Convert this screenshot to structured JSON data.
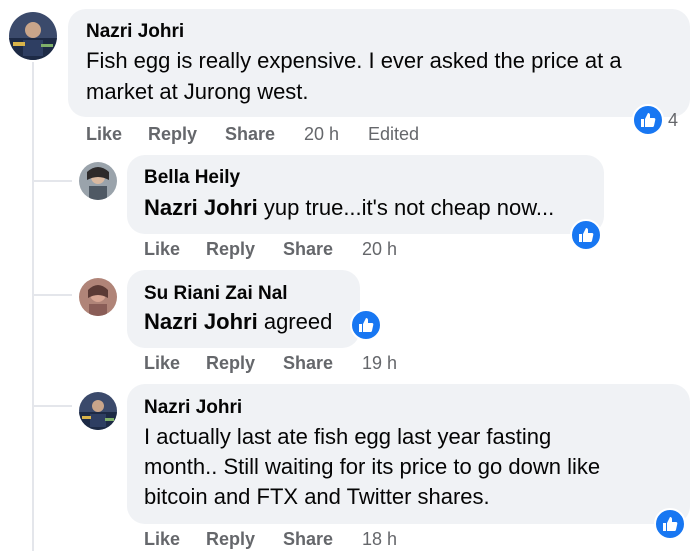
{
  "comments": [
    {
      "author": "Nazri Johri",
      "text": "Fish egg is really expensive. I ever asked the price at a market at Jurong west.",
      "line1": "Fish egg is really expensive. I ever asked the price at a",
      "line2": "market at Jurong west.",
      "actions": {
        "like": "Like",
        "reply": "Reply",
        "share": "Share"
      },
      "time": "20 h",
      "edited": "Edited",
      "reaction_count": "4"
    },
    {
      "author": "Bella Heily",
      "mention": "Nazri Johri",
      "text": "yup true...it's not cheap now...",
      "actions": {
        "like": "Like",
        "reply": "Reply",
        "share": "Share"
      },
      "time": "20 h"
    },
    {
      "author": "Su Riani Zai Nal",
      "mention": "Nazri Johri",
      "text": "agreed",
      "actions": {
        "like": "Like",
        "reply": "Reply",
        "share": "Share"
      },
      "time": "19 h"
    },
    {
      "author": "Nazri Johri",
      "line1": "I actually last ate fish egg last year fasting",
      "line2": "month.. Still waiting for its price to go down like",
      "line3": "bitcoin and FTX and Twitter shares.",
      "actions": {
        "like": "Like",
        "reply": "Reply",
        "share": "Share"
      },
      "time": "18 h"
    }
  ],
  "colors": {
    "bubble": "#f0f2f5",
    "like_blue": "#1877f2",
    "meta_gray": "#65676b"
  }
}
